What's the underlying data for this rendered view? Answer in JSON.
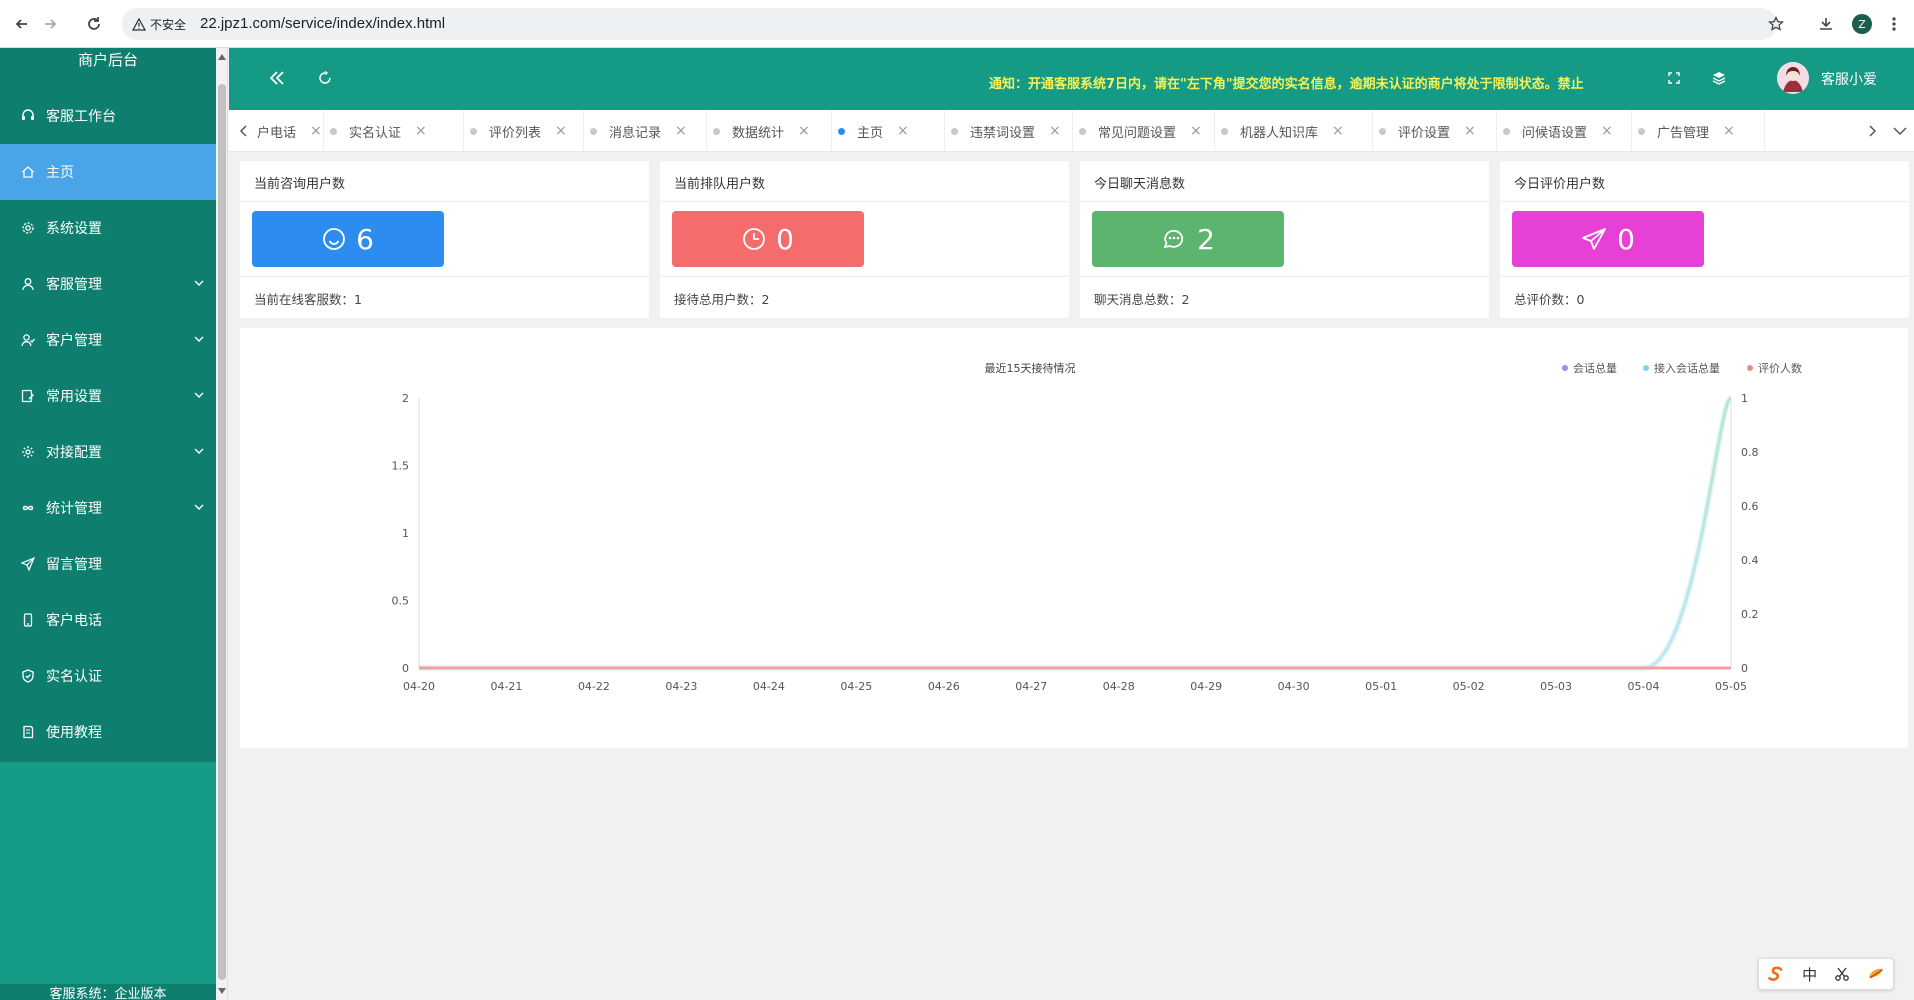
{
  "browser": {
    "insecure_label": "不安全",
    "url": "22.jpz1.com/service/index/index.html",
    "profile_initial": "Z"
  },
  "sidebar": {
    "header": "商户后台",
    "items": [
      {
        "label": "客服工作台",
        "icon": "headset-icon",
        "has_arrow": false,
        "active": false
      },
      {
        "label": "主页",
        "icon": "home-icon",
        "has_arrow": false,
        "active": true
      },
      {
        "label": "系统设置",
        "icon": "gear-icon",
        "has_arrow": false,
        "active": false
      },
      {
        "label": "客服管理",
        "icon": "user-icon",
        "has_arrow": true,
        "active": false
      },
      {
        "label": "客户管理",
        "icon": "users-icon",
        "has_arrow": true,
        "active": false
      },
      {
        "label": "常用设置",
        "icon": "edit-icon",
        "has_arrow": true,
        "active": false
      },
      {
        "label": "对接配置",
        "icon": "cog-icon",
        "has_arrow": true,
        "active": false
      },
      {
        "label": "统计管理",
        "icon": "infinity-icon",
        "has_arrow": true,
        "active": false
      },
      {
        "label": "留言管理",
        "icon": "send-icon",
        "has_arrow": false,
        "active": false
      },
      {
        "label": "客户电话",
        "icon": "phone-icon",
        "has_arrow": false,
        "active": false
      },
      {
        "label": "实名认证",
        "icon": "shield-check-icon",
        "has_arrow": false,
        "active": false
      },
      {
        "label": "使用教程",
        "icon": "book-icon",
        "has_arrow": false,
        "active": false
      }
    ],
    "footer": "客服系统：企业版本"
  },
  "header": {
    "notice": "通知：开通客服系统7日内，请在\"左下角\"提交您的实名信息，逾期未认证的商户将处于限制状态。禁止",
    "user_name": "客服小爱"
  },
  "tabs": [
    {
      "label": "户电话",
      "active": false
    },
    {
      "label": "实名认证",
      "active": false
    },
    {
      "label": "评价列表",
      "active": false
    },
    {
      "label": "消息记录",
      "active": false
    },
    {
      "label": "数据统计",
      "active": false
    },
    {
      "label": "主页",
      "active": true
    },
    {
      "label": "违禁词设置",
      "active": false
    },
    {
      "label": "常见问题设置",
      "active": false
    },
    {
      "label": "机器人知识库",
      "active": false
    },
    {
      "label": "评价设置",
      "active": false
    },
    {
      "label": "问候语设置",
      "active": false
    },
    {
      "label": "广告管理",
      "active": false
    }
  ],
  "cards": [
    {
      "title": "当前咨询用户数",
      "value": "6",
      "color": "#2d8cf0",
      "icon": "smile-icon",
      "footer": "当前在线客服数：1"
    },
    {
      "title": "当前排队用户数",
      "value": "0",
      "color": "#f56c6c",
      "icon": "clock-icon",
      "footer": "接待总用户数：2"
    },
    {
      "title": "今日聊天消息数",
      "value": "2",
      "color": "#5cb46f",
      "icon": "chat-icon",
      "footer": "聊天消息总数：2"
    },
    {
      "title": "今日评价用户数",
      "value": "0",
      "color": "#e640d6",
      "icon": "paper-plane-icon",
      "footer": "总评价数：0"
    }
  ],
  "chart_data": {
    "type": "line",
    "title": "最近15天接待情况",
    "categories": [
      "04-20",
      "04-21",
      "04-22",
      "04-23",
      "04-24",
      "04-25",
      "04-26",
      "04-27",
      "04-28",
      "04-29",
      "04-30",
      "05-01",
      "05-02",
      "05-03",
      "05-04",
      "05-05"
    ],
    "left_yticks": [
      "0",
      "0.5",
      "1",
      "1.5",
      "2"
    ],
    "right_yticks": [
      "0",
      "0.2",
      "0.4",
      "0.6",
      "0.8",
      "1"
    ],
    "left_ylim": [
      0,
      2
    ],
    "right_ylim": [
      0,
      1
    ],
    "legend_position": "top-right",
    "series": [
      {
        "name": "会话总量",
        "color": "#9b8ee8",
        "axis": "left",
        "values": [
          0,
          0,
          0,
          0,
          0,
          0,
          0,
          0,
          0,
          0,
          0,
          0,
          0,
          0,
          0,
          2
        ]
      },
      {
        "name": "接入会话总量",
        "color": "#7fd4f0",
        "axis": "left",
        "values": [
          0,
          0,
          0,
          0,
          0,
          0,
          0,
          0,
          0,
          0,
          0,
          0,
          0,
          0,
          0,
          2
        ]
      },
      {
        "name": "评价人数",
        "color": "#f08a8a",
        "axis": "right",
        "values": [
          0,
          0,
          0,
          0,
          0,
          0,
          0,
          0,
          0,
          0,
          0,
          0,
          0,
          0,
          0,
          0
        ]
      }
    ]
  },
  "ime": {
    "lang": "中"
  }
}
